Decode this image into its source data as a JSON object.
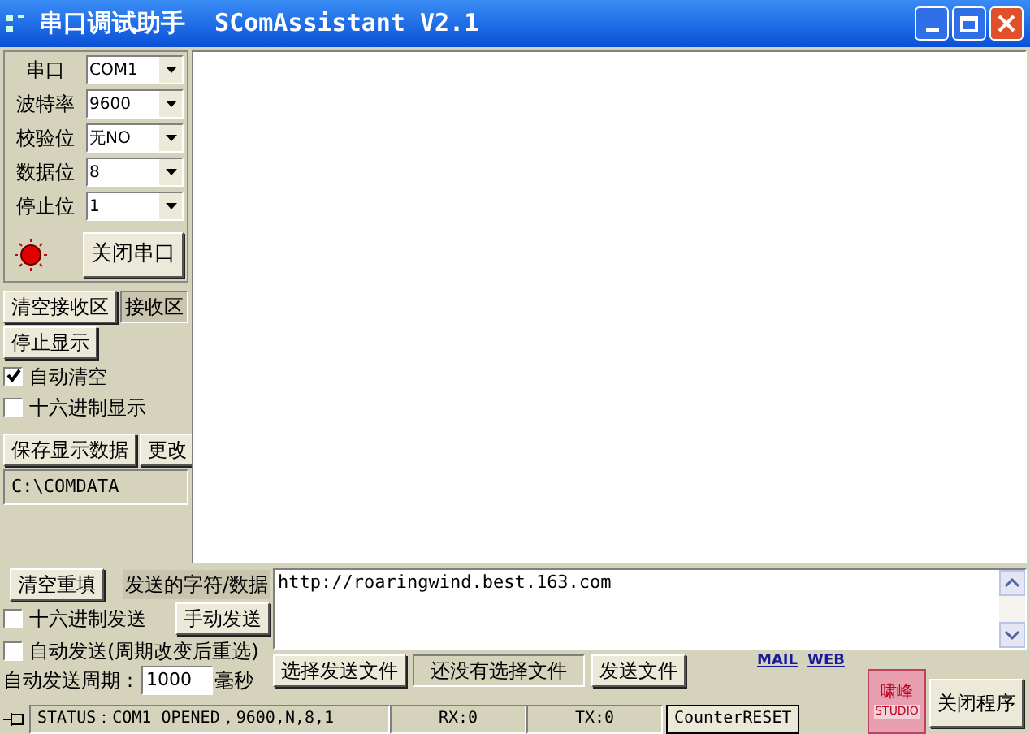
{
  "window": {
    "title": "串口调试助手  SComAssistant V2.1"
  },
  "port_settings": [
    {
      "label": "串口",
      "value": "COM1"
    },
    {
      "label": "波特率",
      "value": "9600"
    },
    {
      "label": "校验位",
      "value": "无NO"
    },
    {
      "label": "数据位",
      "value": "8"
    },
    {
      "label": "停止位",
      "value": "1"
    }
  ],
  "port": {
    "open": true,
    "button": "关闭串口"
  },
  "receive": {
    "clear_button": "清空接收区",
    "area_label": "接收区",
    "stop_button": "停止显示",
    "options": [
      {
        "label": "自动清空",
        "checked": true
      },
      {
        "label": "十六进制显示",
        "checked": false
      }
    ],
    "save_button": "保存显示数据",
    "change_button": "更改",
    "path": "C:\\COMDATA"
  },
  "send": {
    "clear_button": "清空重填",
    "area_label": "发送的字符/数据",
    "hex": {
      "label": "十六进制发送",
      "checked": false
    },
    "manual_button": "手动发送",
    "auto": {
      "label": "自动发送(周期改变后重选)",
      "checked": false
    },
    "period_label": "自动发送周期：",
    "period_value": "1000",
    "period_unit": "毫秒",
    "text": "http://roaringwind.best.163.com",
    "select_file_button": "选择发送文件",
    "file_status": "还没有选择文件",
    "send_file_button": "发送文件",
    "links": [
      "MAIL",
      "WEB"
    ],
    "logo": [
      "啸峰",
      "STUDIO"
    ],
    "close_button": "关闭程序"
  },
  "status_bar": {
    "status": "STATUS：COM1 OPENED，9600,N,8,1",
    "rx": "RX:0",
    "tx": "TX:0",
    "reset_button": "CounterRESET"
  }
}
